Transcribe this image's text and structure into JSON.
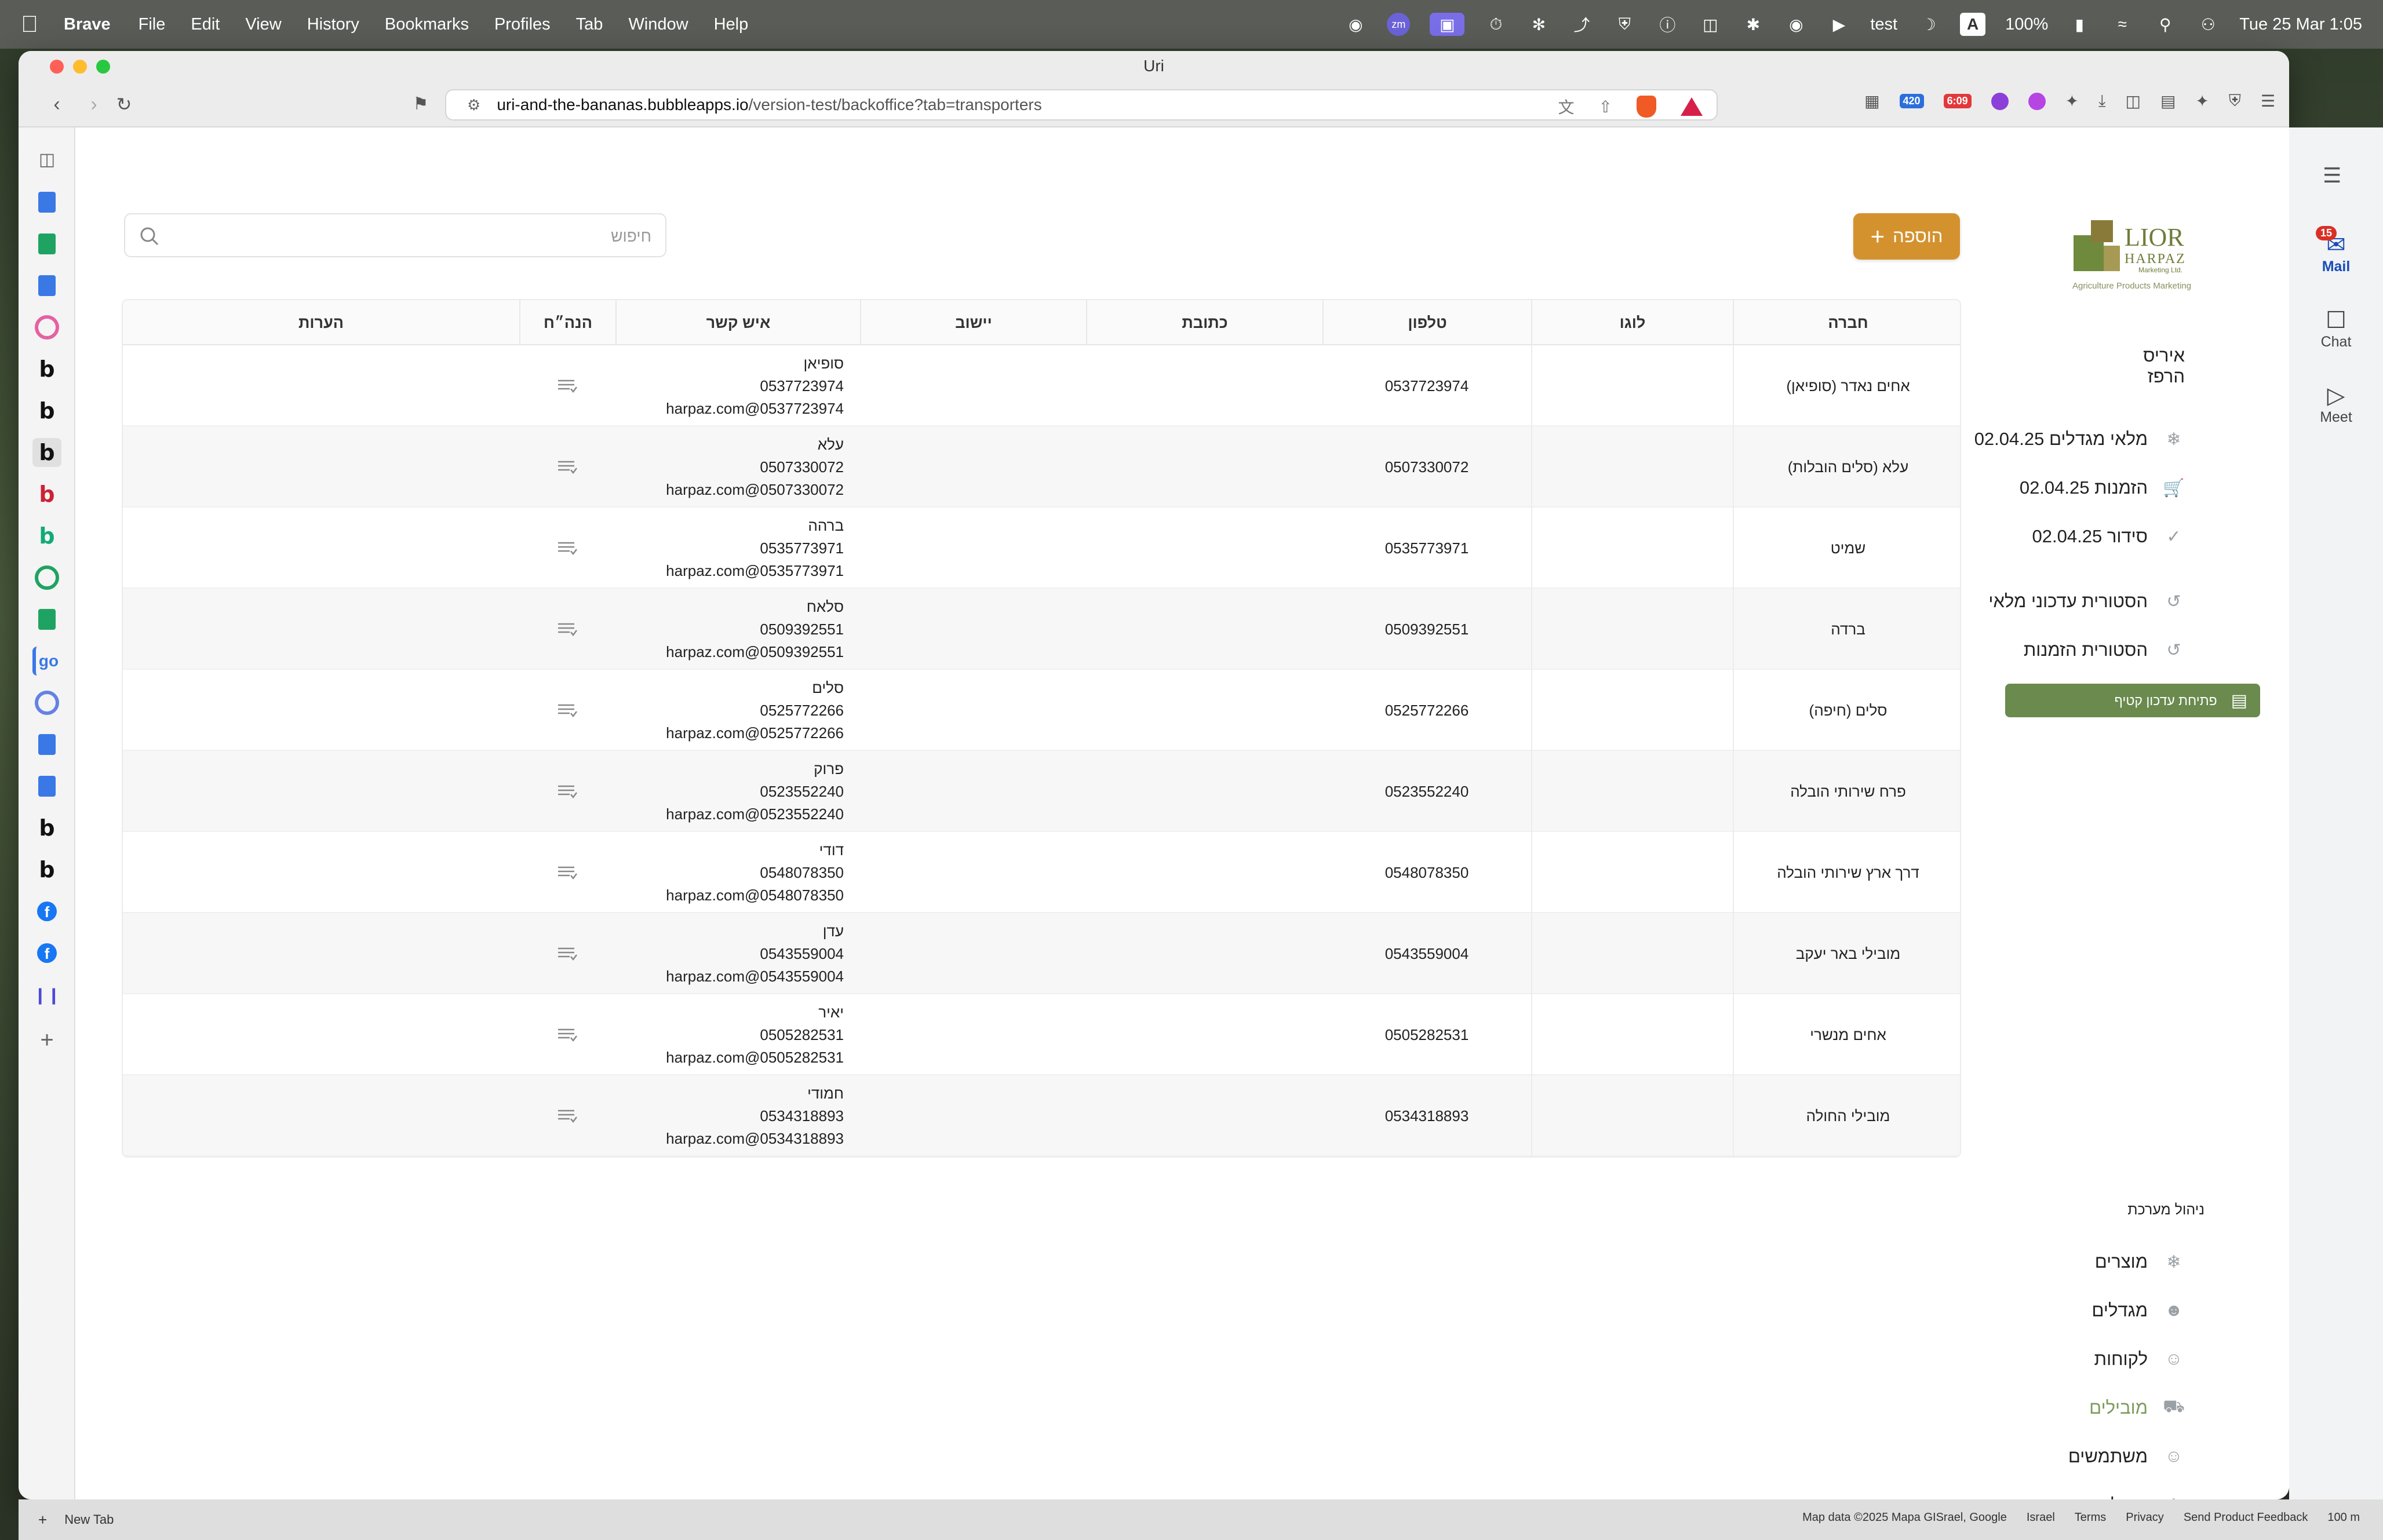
{
  "menubar": {
    "app": "Brave",
    "items": [
      "File",
      "Edit",
      "View",
      "History",
      "Bookmarks",
      "Profiles",
      "Tab",
      "Window",
      "Help"
    ],
    "status_user": "test",
    "battery": "100%",
    "datetime": "Tue 25 Mar  1:05"
  },
  "window": {
    "title": "Uri"
  },
  "browser": {
    "url_host": "uri-and-the-bananas.bubbleapps.io",
    "url_path": "/version-test/backoffice?tab=transporters",
    "ext_badge_blue": "420",
    "ext_badge_red": "6:09"
  },
  "search": {
    "placeholder": "חיפוש"
  },
  "add_button": {
    "label": "הוספה"
  },
  "table": {
    "headers": {
      "company": "חברה",
      "logo": "לוגו",
      "phone": "טלפון",
      "address": "כתובת",
      "settlement": "יישוב",
      "contact": "איש קשר",
      "accounting": "הנה״ח",
      "notes": "הערות"
    },
    "rows": [
      {
        "company": "אחים נאדר (סופיאן)",
        "phone": "0537723974",
        "contact_name": "סופיאן",
        "contact_phone": "0537723974",
        "contact_email": "harpaz.com@0537723974"
      },
      {
        "company": "עלא (סלים הובלות)",
        "phone": "0507330072",
        "contact_name": "עלא",
        "contact_phone": "0507330072",
        "contact_email": "harpaz.com@0507330072"
      },
      {
        "company": "שמיט",
        "phone": "0535773971",
        "contact_name": "ברהה",
        "contact_phone": "0535773971",
        "contact_email": "harpaz.com@0535773971"
      },
      {
        "company": "ברדה",
        "phone": "0509392551",
        "contact_name": "סלאח",
        "contact_phone": "0509392551",
        "contact_email": "harpaz.com@0509392551"
      },
      {
        "company": "סלים (חיפה)",
        "phone": "0525772266",
        "contact_name": "סלים",
        "contact_phone": "0525772266",
        "contact_email": "harpaz.com@0525772266"
      },
      {
        "company": "פרח שירותי הובלה",
        "phone": "0523552240",
        "contact_name": "פרוק",
        "contact_phone": "0523552240",
        "contact_email": "harpaz.com@0523552240"
      },
      {
        "company": "דרך ארץ שירותי הובלה",
        "phone": "0548078350",
        "contact_name": "דודי",
        "contact_phone": "0548078350",
        "contact_email": "harpaz.com@0548078350"
      },
      {
        "company": "מובילי באר יעקב",
        "phone": "0543559004",
        "contact_name": "עדן",
        "contact_phone": "0543559004",
        "contact_email": "harpaz.com@0543559004"
      },
      {
        "company": "אחים מנשרי",
        "phone": "0505282531",
        "contact_name": "יאיר",
        "contact_phone": "0505282531",
        "contact_email": "harpaz.com@0505282531"
      },
      {
        "company": "מובילי החולה",
        "phone": "0534318893",
        "contact_name": "חמודי",
        "contact_phone": "0534318893",
        "contact_email": "harpaz.com@0534318893"
      }
    ]
  },
  "logo": {
    "brand_top": "LIOR",
    "brand_bottom": "HARPAZ",
    "small": "Marketing Ltd.",
    "tagline": "Agriculture Products Marketing"
  },
  "user": {
    "first": "איריס",
    "last": "הרפז"
  },
  "side_nav": {
    "inventory": "מלאי מגדלים 02.04.25",
    "orders": "הזמנות 02.04.25",
    "arrangement": "סידור 02.04.25",
    "inventory_history": "הסטורית עדכוני מלאי",
    "orders_history": "הסטורית הזמנות",
    "open_small_update": "פתיחת עדכון קטיף",
    "admin_section": "ניהול מערכת",
    "products": "מוצרים",
    "growers": "מגדלים",
    "customers": "לקוחות",
    "transporters": "מובילים",
    "users": "משתמשים",
    "system_admin": "ניהול מערכת"
  },
  "google_sidebar": {
    "mail": "Mail",
    "mail_badge": "15",
    "chat": "Chat",
    "meet": "Meet"
  },
  "bottom": {
    "new_tab": "New Tab",
    "map_data": "Map data ©2025 Mapa GISrael, Google",
    "israel": "Israel",
    "terms": "Terms",
    "privacy": "Privacy",
    "feedback": "Send Product Feedback",
    "scale": "100 m"
  },
  "colors": {
    "accent_orange": "#d4922e",
    "accent_green": "#6a8a4e",
    "active_nav": "#7d9b5c"
  }
}
